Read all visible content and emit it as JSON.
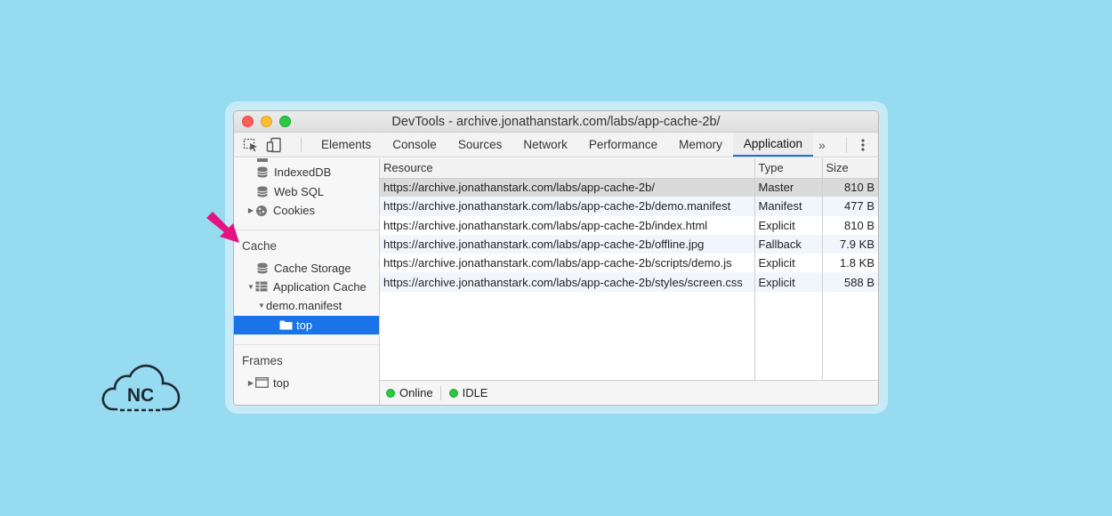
{
  "window": {
    "title": "DevTools - archive.jonathanstark.com/labs/app-cache-2b/"
  },
  "toolbar": {
    "tabs": [
      {
        "label": "Elements",
        "active": false
      },
      {
        "label": "Console",
        "active": false
      },
      {
        "label": "Sources",
        "active": false
      },
      {
        "label": "Network",
        "active": false
      },
      {
        "label": "Performance",
        "active": false
      },
      {
        "label": "Memory",
        "active": false
      },
      {
        "label": "Application",
        "active": true
      }
    ],
    "more_label": "»",
    "menu_label": "⋮"
  },
  "sidebar": {
    "items": [
      {
        "label": "IndexedDB"
      },
      {
        "label": "Web SQL"
      },
      {
        "label": "Cookies"
      }
    ],
    "cache_section": "Cache",
    "cache_items": [
      {
        "label": "Cache Storage"
      },
      {
        "label": "Application Cache"
      },
      {
        "label": "demo.manifest"
      },
      {
        "label": "top"
      }
    ],
    "frames_section": "Frames",
    "frames_items": [
      {
        "label": "top"
      }
    ]
  },
  "table": {
    "headers": {
      "resource": "Resource",
      "type": "Type",
      "size": "Size"
    },
    "rows": [
      {
        "resource": "https://archive.jonathanstark.com/labs/app-cache-2b/",
        "type": "Master",
        "size": "810 B"
      },
      {
        "resource": "https://archive.jonathanstark.com/labs/app-cache-2b/demo.manifest",
        "type": "Manifest",
        "size": "477 B"
      },
      {
        "resource": "https://archive.jonathanstark.com/labs/app-cache-2b/index.html",
        "type": "Explicit",
        "size": "810 B"
      },
      {
        "resource": "https://archive.jonathanstark.com/labs/app-cache-2b/offline.jpg",
        "type": "Fallback",
        "size": "7.9 KB"
      },
      {
        "resource": "https://archive.jonathanstark.com/labs/app-cache-2b/scripts/demo.js",
        "type": "Explicit",
        "size": "1.8 KB"
      },
      {
        "resource": "https://archive.jonathanstark.com/labs/app-cache-2b/styles/screen.css",
        "type": "Explicit",
        "size": "588 B"
      }
    ]
  },
  "status": {
    "online": "Online",
    "idle": "IDLE"
  },
  "logo": {
    "text": "NC"
  },
  "colors": {
    "background": "#96dbef",
    "accent": "#1a73e8",
    "arrow": "#e5137f",
    "status_green": "#28c840"
  }
}
